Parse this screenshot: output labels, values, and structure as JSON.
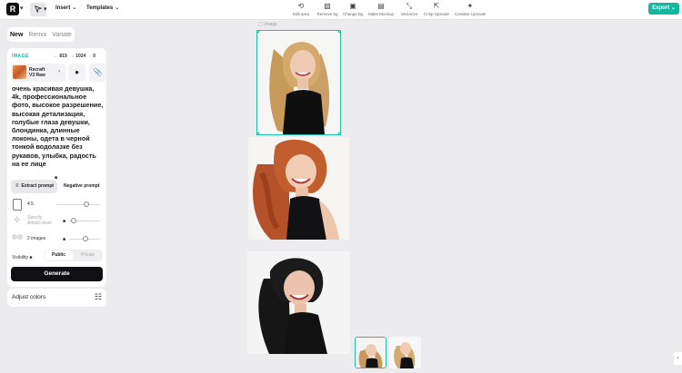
{
  "app": {
    "logo_text": "R",
    "menus": [
      {
        "label": "Insert"
      },
      {
        "label": "Templates"
      }
    ],
    "tools": [
      {
        "label": "Edit area",
        "icon": "lasso-icon"
      },
      {
        "label": "Remove bg",
        "icon": "remove-bg-icon"
      },
      {
        "label": "Change bg",
        "icon": "change-bg-icon"
      },
      {
        "label": "Make Mockup",
        "icon": "mockup-icon"
      },
      {
        "label": "Vectorize",
        "icon": "vectorize-icon"
      },
      {
        "label": "Crisp Upscale",
        "icon": "crisp-upscale-icon"
      },
      {
        "label": "Creative Upscale",
        "icon": "creative-upscale-icon"
      }
    ],
    "export_label": "Export",
    "accent": "#15b79e"
  },
  "tabs": [
    {
      "label": "New",
      "active": true
    },
    {
      "label": "Remix",
      "active": false
    },
    {
      "label": "Variate",
      "active": false
    }
  ],
  "panel": {
    "section_label": "IMAGE",
    "width": "819",
    "height": "1024",
    "count": "0",
    "model_name_line1": "Recraft",
    "model_name_line2": "V3 Raw",
    "prompt": "очень красивая девушка, 4k, профессиональное фото, высокое разрешение, высокая детализация, голубые глаза девушки, блондинка, длинные локоны, одета в черной тонкой водолазке без рукавов, улыбка, радость на ее лице",
    "extract_label": "Extract prompt",
    "negative_label": "Negative prompt",
    "aspect_label": "4:5",
    "artistic_label_line1": "Specify",
    "artistic_label_line2": "Artistic level",
    "images_label": "2 images",
    "visibility_label": "Visibility",
    "public_label": "Public",
    "private_label": "Private",
    "generate_label": "Generate",
    "adjust_colors_label": "Adjust colors"
  },
  "canvas": {
    "selected_caption": "Image"
  }
}
